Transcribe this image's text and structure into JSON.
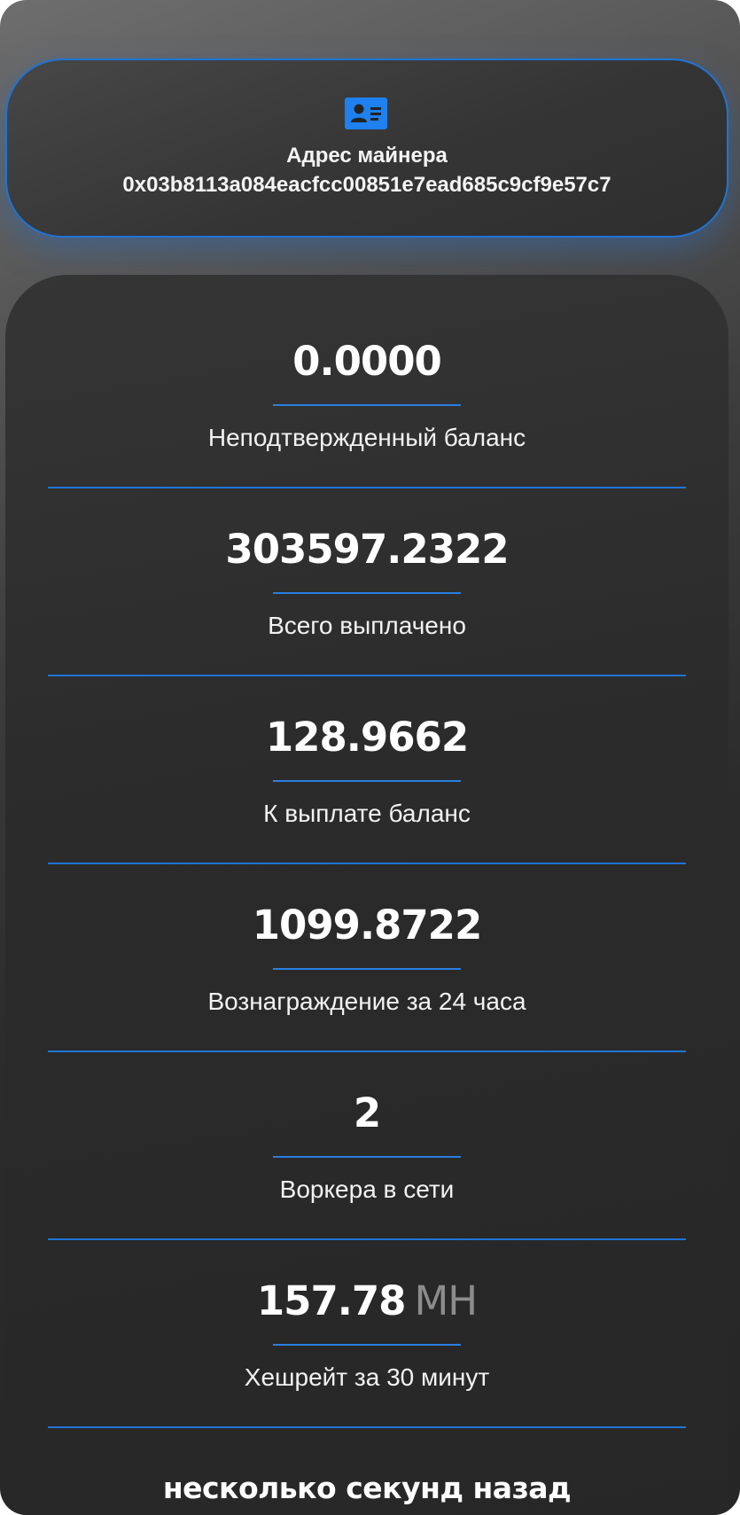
{
  "miner": {
    "icon": "id-card-icon",
    "title": "Адрес майнера",
    "address": "0x03b8113a084eacfcc00851e7ead685c9cf9e57c7"
  },
  "stats": [
    {
      "value": "0.0000",
      "unit": "",
      "label": "Неподтвержденный баланс"
    },
    {
      "value": "303597.2322",
      "unit": "",
      "label": "Всего выплачено"
    },
    {
      "value": "128.9662",
      "unit": "",
      "label": "К выплате баланс"
    },
    {
      "value": "1099.8722",
      "unit": "",
      "label": "Вознаграждение за 24 часа"
    },
    {
      "value": "2",
      "unit": "",
      "label": "Воркера в сети"
    },
    {
      "value": "157.78",
      "unit": "MH",
      "label": "Хешрейт за 30 минут"
    }
  ],
  "updated": "несколько секунд назад",
  "colors": {
    "accent": "#1f74d6",
    "background": "#2b2b2b",
    "text": "#ffffff",
    "unit_text": "#8c8c8c"
  }
}
